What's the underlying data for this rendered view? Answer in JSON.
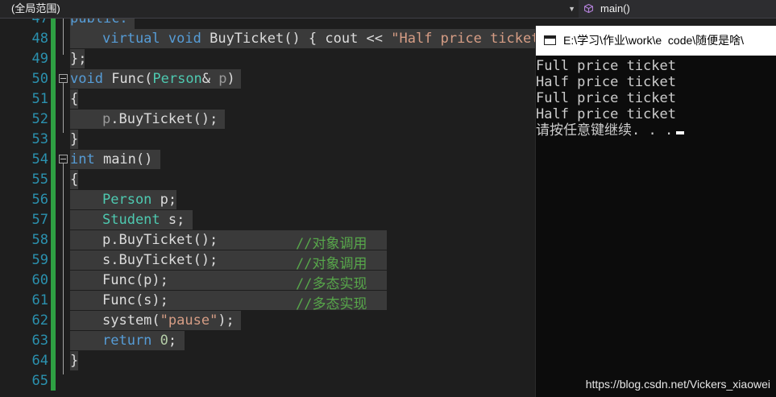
{
  "toolbar": {
    "scope_label": "(全局范围)",
    "member_label": "main()"
  },
  "editor": {
    "line_numbers": [
      "47",
      "48",
      "49",
      "50",
      "51",
      "52",
      "53",
      "54",
      "55",
      "56",
      "57",
      "58",
      "59",
      "60",
      "61",
      "62",
      "63",
      "64",
      "65"
    ],
    "line47": {
      "text": "public:"
    },
    "line48": {
      "kw1": "virtual",
      "kw2": "void",
      "rest": " BuyTicket() { cout << ",
      "str": "\"Half price ticket\""
    },
    "line49": {
      "text": "};"
    },
    "line50": {
      "kw": "void",
      "name": " Func(",
      "type": "Person",
      "amp": "& ",
      "param": "p",
      "close": ")"
    },
    "line51": {
      "text": "{"
    },
    "line52": {
      "param": "p",
      "rest": ".BuyTicket();"
    },
    "line53": {
      "text": "}"
    },
    "line54": {
      "kw": "int",
      "rest": " main()"
    },
    "line55": {
      "text": "{"
    },
    "line56": {
      "type": "Person",
      "rest": " p;"
    },
    "line57": {
      "type": "Student",
      "rest": " s;"
    },
    "line58": {
      "code": "p.BuyTicket();",
      "comment": "//对象调用"
    },
    "line59": {
      "code": "s.BuyTicket();",
      "comment": "//对象调用"
    },
    "line60": {
      "code": "Func(p);",
      "comment": "//多态实现"
    },
    "line61": {
      "code": "Func(s);",
      "comment": "//多态实现"
    },
    "line62": {
      "code": "system(",
      "str": "\"pause\"",
      "close": ");"
    },
    "line63": {
      "kw": "return",
      "num": " 0",
      "close": ";"
    },
    "line64": {
      "text": "}"
    }
  },
  "console": {
    "title": "E:\\学习\\作业\\work\\e  code\\随便是啥\\",
    "output": [
      "Full price ticket",
      "Half price ticket",
      "Full price ticket",
      "Half price ticket",
      "请按任意键继续. . ."
    ]
  },
  "watermark": "https://blog.csdn.net/Vickers_xiaowei"
}
